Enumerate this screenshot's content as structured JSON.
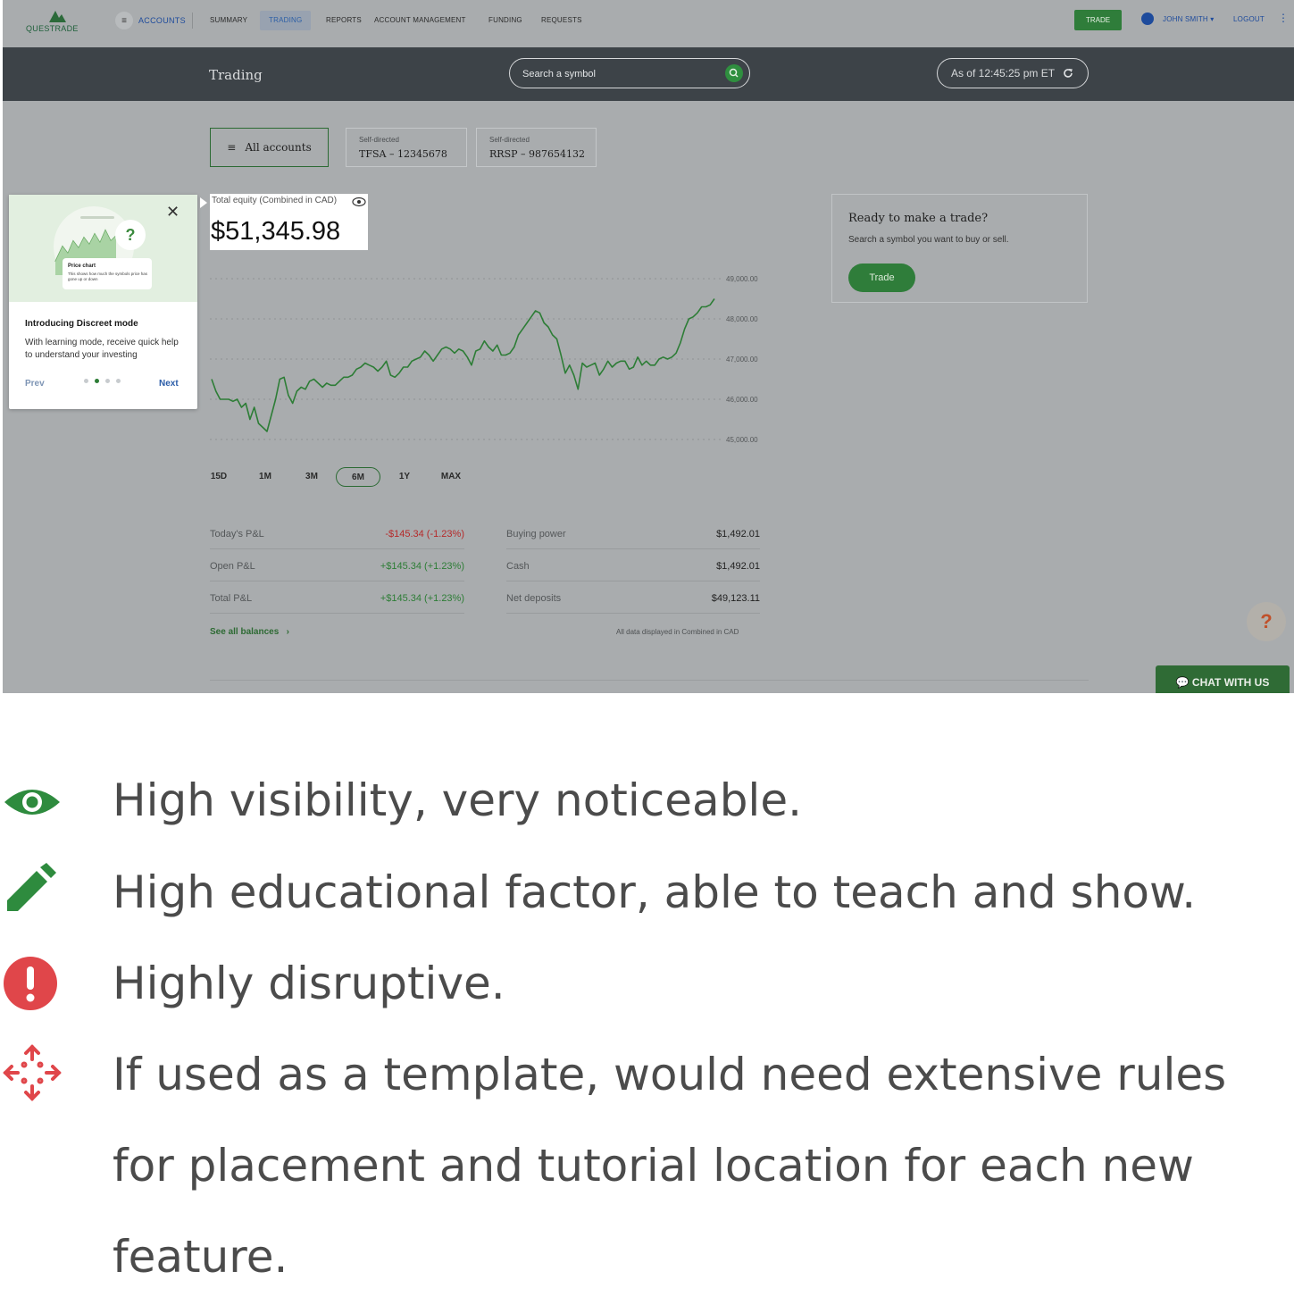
{
  "topnav": {
    "logo_text": "QUESTRADE",
    "accounts_label": "ACCOUNTS",
    "items": [
      {
        "label": "SUMMARY"
      },
      {
        "label": "TRADING"
      },
      {
        "label": "REPORTS"
      },
      {
        "label": "ACCOUNT MANAGEMENT"
      },
      {
        "label": "FUNDING"
      },
      {
        "label": "REQUESTS"
      }
    ],
    "active_item": "TRADING",
    "trade_button": "TRADE",
    "user_name": "JOHN SMITH ▾",
    "logout": "LOGOUT"
  },
  "subheader": {
    "title": "Trading",
    "search_placeholder": "Search a symbol",
    "as_of": "As of 12:45:25 pm ET"
  },
  "accounts": {
    "all_label": "All accounts",
    "chips": [
      {
        "type": "Self-directed",
        "name": "TFSA – 12345678"
      },
      {
        "type": "Self-directed",
        "name": "RRSP – 987654132"
      }
    ]
  },
  "equity": {
    "label": "Total equity (Combined in CAD)",
    "value": "$51,345.98"
  },
  "chart_data": {
    "type": "line",
    "y_ticks": [
      "49,000.00",
      "48,000.00",
      "47,000.00",
      "46,000.00",
      "45,000.00"
    ],
    "ylim": [
      45000,
      49000
    ],
    "grid": true,
    "series": [
      {
        "values": [
          46500,
          46200,
          46000,
          46000,
          46000,
          45950,
          46000,
          45800,
          45900,
          45500,
          45800,
          45400,
          45300,
          45200,
          45600,
          46000,
          46500,
          46550,
          46100,
          45900,
          46200,
          46300,
          46250,
          46450,
          46500,
          46400,
          46300,
          46400,
          46350,
          46350,
          46450,
          46550,
          46550,
          46600,
          46750,
          46800,
          46900,
          46850,
          46800,
          46700,
          46800,
          46950,
          46600,
          46550,
          46650,
          46800,
          46800,
          46950,
          47000,
          47050,
          47200,
          47100,
          46950,
          47100,
          47250,
          47300,
          47250,
          47150,
          47250,
          47200,
          47050,
          46850,
          47200,
          47250,
          47450,
          47300,
          47200,
          47350,
          47100,
          47100,
          47150,
          47300,
          47600,
          47750,
          47900,
          48050,
          48200,
          48150,
          47900,
          47800,
          47600,
          47500,
          47100,
          46650,
          46850,
          46600,
          46250,
          46900,
          46800,
          46850,
          46900,
          46600,
          46750,
          46950,
          46800,
          46900,
          46950,
          46950,
          46750,
          46800,
          47050,
          46850,
          46950,
          46850,
          46850,
          47000,
          47050,
          47000,
          47050,
          47150,
          47400,
          47750,
          48000,
          48050,
          48150,
          48300,
          48300,
          48350,
          48500
        ]
      }
    ],
    "ranges": [
      "15D",
      "1M",
      "3M",
      "6M",
      "1Y",
      "MAX"
    ],
    "active_range": "6M"
  },
  "stats": {
    "left": [
      {
        "label": "Today's P&L",
        "value": "-$145.34  (-1.23%)",
        "tone": "neg"
      },
      {
        "label": "Open P&L",
        "value": "+$145.34  (+1.23%)",
        "tone": "pos"
      },
      {
        "label": "Total P&L",
        "value": "+$145.34  (+1.23%)",
        "tone": "pos"
      }
    ],
    "right": [
      {
        "label": "Buying power",
        "value": "$1,492.01"
      },
      {
        "label": "Cash",
        "value": "$1,492.01"
      },
      {
        "label": "Net deposits",
        "value": "$49,123.11"
      }
    ],
    "see_all": "See all balances",
    "note": "All data displayed in Combined in CAD"
  },
  "ready_card": {
    "title": "Ready to make a trade?",
    "subtitle": "Search a symbol you want to buy or sell.",
    "button": "Trade"
  },
  "help_label": "?",
  "chat_label": "CHAT WITH US",
  "tutorial": {
    "mini_title": "Price chart",
    "mini_body": "This shows how much the symbols price has gone up or down",
    "bubble": "?",
    "title": "Introducing Discreet mode",
    "body": "With learning mode, receive quick help to understand your investing",
    "prev": "Prev",
    "next": "Next",
    "step": 2,
    "steps": 4
  },
  "legend": [
    {
      "icon": "eye-icon",
      "color": "#2e8b3e",
      "text": "High visibility, very noticeable."
    },
    {
      "icon": "pencil-icon",
      "color": "#2e8b3e",
      "text": "High educational factor, able to teach and show."
    },
    {
      "icon": "exclamation-icon",
      "color": "#e0464a",
      "text": "Highly disruptive."
    },
    {
      "icon": "move-arrows-icon",
      "color": "#e0464a",
      "text_lines": [
        "If used as a template, would need extensive rules",
        "for placement and tutorial location for each new",
        "feature."
      ]
    }
  ]
}
